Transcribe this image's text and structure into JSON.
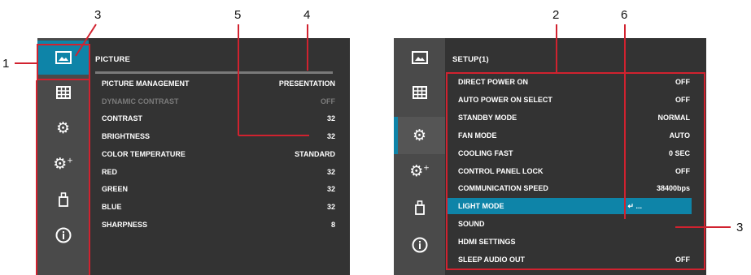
{
  "callouts": {
    "c1": "1",
    "c2": "2",
    "c3a": "3",
    "c3b": "3",
    "c4": "4",
    "c5": "5",
    "c6": "6"
  },
  "left_panel": {
    "title": "PICTURE",
    "sidebar": [
      {
        "icon": "picture-icon",
        "active": true
      },
      {
        "icon": "grid-icon",
        "active": false
      },
      {
        "icon": "gear-icon",
        "active": false
      },
      {
        "icon": "gear-plus-icon",
        "active": false
      },
      {
        "icon": "usb-icon",
        "active": false
      },
      {
        "icon": "info-icon",
        "active": false
      }
    ],
    "rows": [
      {
        "label": "PICTURE MANAGEMENT",
        "value": "PRESENTATION",
        "disabled": false
      },
      {
        "label": "DYNAMIC CONTRAST",
        "value": "OFF",
        "disabled": true
      },
      {
        "label": "CONTRAST",
        "value": "32",
        "disabled": false
      },
      {
        "label": "BRIGHTNESS",
        "value": "32",
        "disabled": false
      },
      {
        "label": "COLOR TEMPERATURE",
        "value": "STANDARD",
        "disabled": false
      },
      {
        "label": "RED",
        "value": "32",
        "disabled": false
      },
      {
        "label": "GREEN",
        "value": "32",
        "disabled": false
      },
      {
        "label": "BLUE",
        "value": "32",
        "disabled": false
      },
      {
        "label": "SHARPNESS",
        "value": "8",
        "disabled": false
      }
    ]
  },
  "right_panel": {
    "title": "SETUP(1)",
    "sidebar": [
      {
        "icon": "picture-icon",
        "active": false
      },
      {
        "icon": "grid-icon",
        "active": false
      },
      {
        "icon": "gear-icon",
        "active": true
      },
      {
        "icon": "gear-plus-icon",
        "active": false
      },
      {
        "icon": "usb-icon",
        "active": false
      },
      {
        "icon": "info-icon",
        "active": false
      }
    ],
    "rows": [
      {
        "label": "DIRECT POWER ON",
        "value": "OFF"
      },
      {
        "label": "AUTO POWER ON SELECT",
        "value": "OFF"
      },
      {
        "label": "STANDBY MODE",
        "value": "NORMAL"
      },
      {
        "label": "FAN MODE",
        "value": "AUTO"
      },
      {
        "label": "COOLING FAST",
        "value": "0 SEC"
      },
      {
        "label": "CONTROL PANEL LOCK",
        "value": "OFF"
      },
      {
        "label": "COMMUNICATION SPEED",
        "value": "38400bps"
      },
      {
        "label": "LIGHT MODE",
        "value": "↵ ...",
        "highlight": true
      },
      {
        "label": "SOUND",
        "value": ""
      },
      {
        "label": "HDMI SETTINGS",
        "value": ""
      },
      {
        "label": "SLEEP AUDIO OUT",
        "value": "OFF"
      }
    ]
  },
  "colors": {
    "accent": "#0e84a8",
    "callout_red": "#d1222f",
    "panel": "#333333",
    "sidebar": "#4a4a4a"
  }
}
